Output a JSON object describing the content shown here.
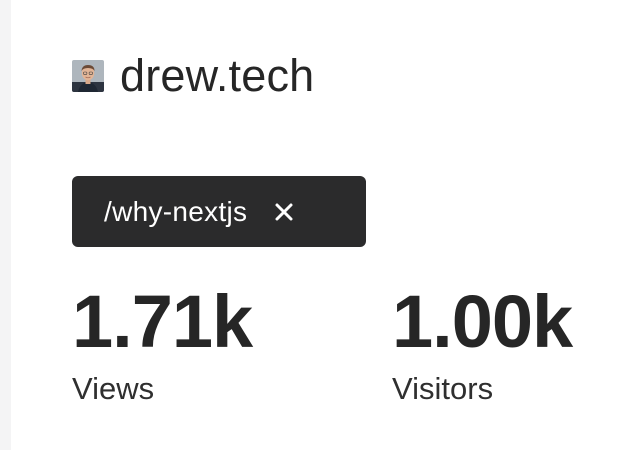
{
  "site": {
    "name": "drew.tech",
    "avatar_icon": "user-avatar-photo"
  },
  "filter": {
    "path": "/why-nextjs",
    "close_icon": "close-icon",
    "background": "#2b2b2c",
    "text_color": "#ffffff"
  },
  "stats": {
    "views": {
      "value": "1.71k",
      "label": "Views"
    },
    "visitors": {
      "value": "1.00k",
      "label": "Visitors"
    }
  }
}
